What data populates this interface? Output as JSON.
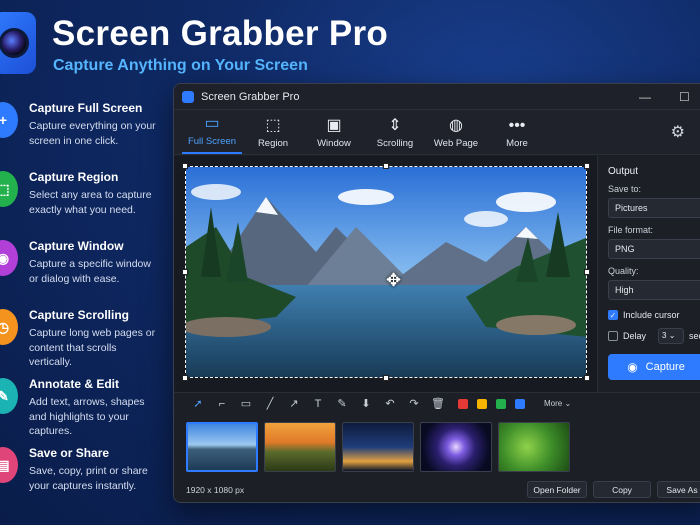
{
  "hero": {
    "title": "Screen Grabber Pro",
    "subtitle": "Capture Anything on Your Screen"
  },
  "features": [
    {
      "icon": "plus-icon",
      "color": "#2f7bff",
      "name": "Capture Full Screen",
      "desc": "Capture everything on your screen in one click."
    },
    {
      "icon": "region-icon",
      "color": "#22b14c",
      "name": "Capture Region",
      "desc": "Select any area to capture exactly what you need."
    },
    {
      "icon": "camera-icon",
      "color": "#b13fd8",
      "name": "Capture Window",
      "desc": "Capture a specific window or dialog with ease."
    },
    {
      "icon": "timer-icon",
      "color": "#f5931f",
      "name": "Capture Scrolling",
      "desc": "Capture long web pages or content that scrolls vertically."
    },
    {
      "icon": "pencil-icon",
      "color": "#1bb3b3",
      "name": "Annotate & Edit",
      "desc": "Add text, arrows, shapes and highlights to your captures."
    },
    {
      "icon": "save-icon",
      "color": "#e0457a",
      "name": "Save or Share",
      "desc": "Save, copy, print or share your captures instantly."
    }
  ],
  "window": {
    "title": "Screen Grabber Pro",
    "tools": [
      {
        "icon": "monitor-icon",
        "label": "Full Screen",
        "active": true
      },
      {
        "icon": "region-icon",
        "label": "Region",
        "active": false
      },
      {
        "icon": "window-icon",
        "label": "Window",
        "active": false
      },
      {
        "icon": "scrolling-icon",
        "label": "Scrolling",
        "active": false
      },
      {
        "icon": "globe-icon",
        "label": "Web Page",
        "active": false
      },
      {
        "icon": "more-icon",
        "label": "More",
        "active": false
      }
    ],
    "output": {
      "heading": "Output",
      "save_to_label": "Save to:",
      "save_to_value": "Pictures",
      "format_label": "File format:",
      "format_value": "PNG",
      "quality_label": "Quality:",
      "quality_value": "High",
      "include_cursor_label": "Include cursor",
      "include_cursor_checked": true,
      "delay_label": "Delay",
      "delay_checked": false,
      "delay_value": "3",
      "delay_unit": "sec",
      "capture_label": "Capture"
    },
    "annotation": {
      "colors": [
        "#e53935",
        "#f5b400",
        "#22b14c",
        "#2f7bff"
      ],
      "more_label": "More"
    },
    "status": {
      "resolution": "1920 x 1080 px",
      "open_folder": "Open Folder",
      "copy": "Copy",
      "save_as": "Save As"
    }
  }
}
